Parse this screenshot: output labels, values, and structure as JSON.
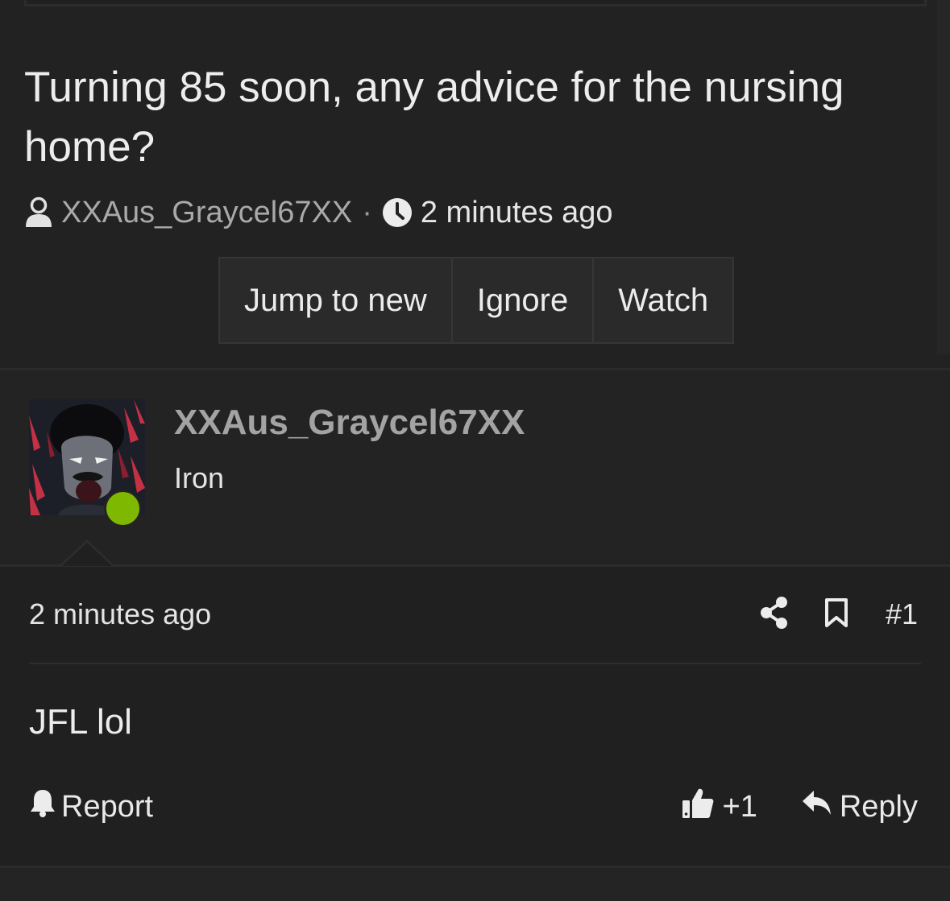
{
  "thread": {
    "title": "Turning 85 soon, any advice for the nursing home?",
    "author": "XXAus_Graycel67XX",
    "separator": "·",
    "time": "2 minutes ago"
  },
  "actions": {
    "jump": "Jump to new",
    "ignore": "Ignore",
    "watch": "Watch"
  },
  "post": {
    "username": "XXAus_Graycel67XX",
    "user_title": "Iron",
    "online_color": "#7fb800",
    "time": "2 minutes ago",
    "number": "#1",
    "body": "JFL lol",
    "report": "Report",
    "like_count": "+1",
    "reply": "Reply"
  },
  "icons": [
    "user-icon",
    "clock-icon",
    "share-icon",
    "bookmark-icon",
    "bell-icon",
    "thumbs-up-icon",
    "reply-icon"
  ]
}
